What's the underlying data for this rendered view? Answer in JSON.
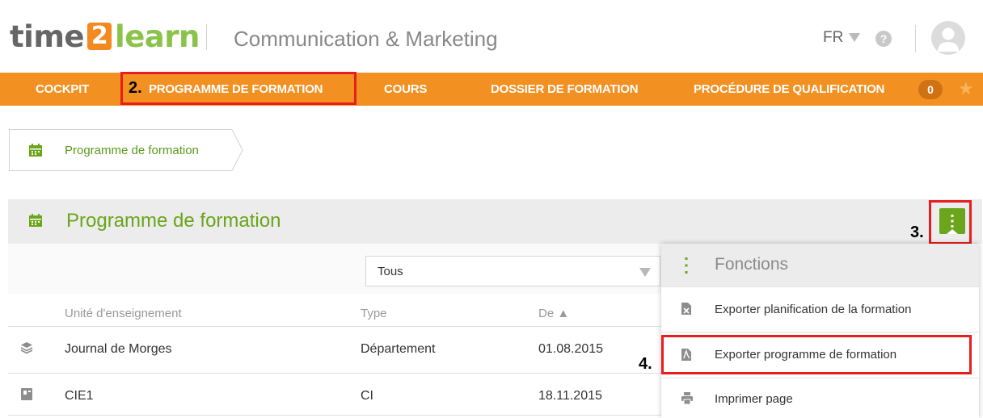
{
  "header": {
    "logo": {
      "part1": "time",
      "part2": "2",
      "part3": "learn"
    },
    "subtitle": "Communication & Marketing",
    "language": "FR",
    "help_symbol": "?"
  },
  "nav": {
    "items": [
      {
        "label": "COCKPIT"
      },
      {
        "label": "PROGRAMME DE FORMATION"
      },
      {
        "label": "COURS"
      },
      {
        "label": "DOSSIER DE FORMATION"
      },
      {
        "label": "PROCÉDURE DE QUALIFICATION"
      }
    ],
    "badge_count": "0"
  },
  "annotations": {
    "step2": "2.",
    "step3": "3.",
    "step4": "4."
  },
  "breadcrumb": {
    "label": "Programme de formation"
  },
  "panel": {
    "title": "Programme de formation",
    "filter": {
      "selected": "Tous"
    },
    "table": {
      "headers": {
        "unit": "Unité d'enseignement",
        "type": "Type",
        "from": "De ▲"
      },
      "rows": [
        {
          "unit": "Journal de Morges",
          "type": "Département",
          "from": "01.08.2015"
        },
        {
          "unit": "CIE1",
          "type": "CI",
          "from": "18.11.2015"
        }
      ]
    }
  },
  "functions_menu": {
    "title": "Fonctions",
    "items": [
      {
        "label": "Exporter planification de la formation"
      },
      {
        "label": "Exporter programme de formation"
      },
      {
        "label": "Imprimer page"
      }
    ]
  },
  "colors": {
    "orange": "#f39022",
    "green": "#6aa51b",
    "annotation_red": "#e81d1d"
  }
}
